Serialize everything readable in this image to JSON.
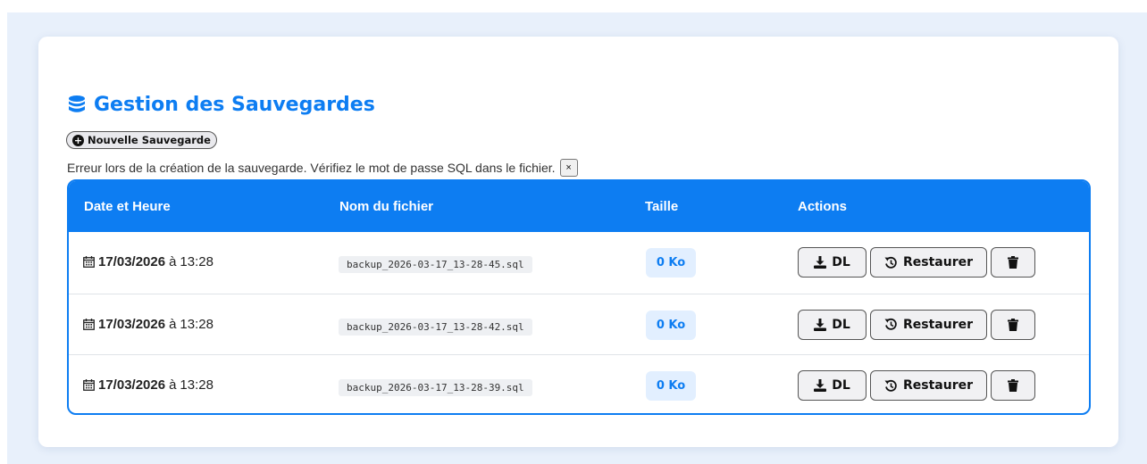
{
  "header": {
    "title": "Gestion des Sauvegardes",
    "new_backup_label": "Nouvelle Sauvegarde"
  },
  "alert": {
    "message": "Erreur lors de la création de la sauvegarde. Vérifiez le mot de passe SQL dans le fichier.",
    "close_label": "×"
  },
  "table": {
    "columns": [
      "Date et Heure",
      "Nom du fichier",
      "Taille",
      "Actions"
    ],
    "rows": [
      {
        "date": "17/03/2026",
        "sep": "à",
        "time": "13:28",
        "filename": "backup_2026-03-17_13-28-45.sql",
        "size": "0 Ko"
      },
      {
        "date": "17/03/2026",
        "sep": "à",
        "time": "13:28",
        "filename": "backup_2026-03-17_13-28-42.sql",
        "size": "0 Ko"
      },
      {
        "date": "17/03/2026",
        "sep": "à",
        "time": "13:28",
        "filename": "backup_2026-03-17_13-28-39.sql",
        "size": "0 Ko"
      }
    ],
    "actions": {
      "download_label": "DL",
      "restore_label": "Restaurer"
    }
  },
  "icons": {
    "title": "database-icon",
    "new_backup": "plus-circle-icon",
    "date": "calendar-icon",
    "download": "download-icon",
    "restore": "history-icon",
    "delete": "trash-icon"
  },
  "colors": {
    "accent": "#0d7df2",
    "page_background": "#e8f0fb",
    "badge_background": "#e2efff"
  }
}
